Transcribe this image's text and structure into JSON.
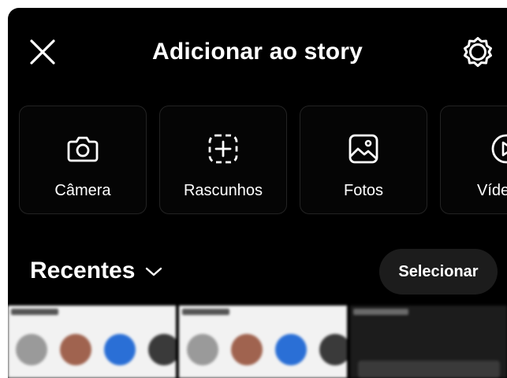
{
  "header": {
    "title": "Adicionar ao story",
    "close_icon": "close-icon",
    "settings_icon": "gear-icon"
  },
  "tiles": [
    {
      "label": "Câmera",
      "icon": "camera-icon"
    },
    {
      "label": "Rascunhos",
      "icon": "drafts-icon"
    },
    {
      "label": "Fotos",
      "icon": "photos-icon"
    },
    {
      "label": "Víde",
      "icon": "video-icon"
    }
  ],
  "gallery": {
    "album_label": "Recentes",
    "select_label": "Selecionar"
  },
  "colors": {
    "background": "#000000",
    "text": "#ffffff",
    "tile_border": "#232323",
    "select_bg": "#1c1c1c"
  }
}
